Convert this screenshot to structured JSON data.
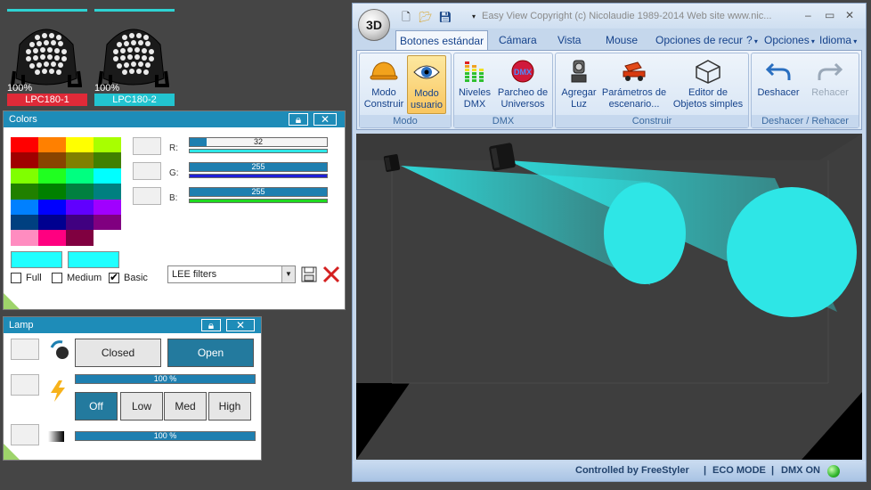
{
  "fixtures": [
    {
      "percent": "100%",
      "name": "LPC180-1",
      "name_color": "#e02a38"
    },
    {
      "percent": "100%",
      "name": "LPC180-2",
      "name_color": "#22c4d0"
    }
  ],
  "colors_panel": {
    "title": "Colors",
    "palette": [
      [
        "#ff0000",
        "#ff8000",
        "#ffff00",
        "#a8ff00"
      ],
      [
        "#a00000",
        "#884400",
        "#808000",
        "#408000"
      ],
      [
        "#80ff00",
        "#20ff20",
        "#00ff80",
        "#00ffff"
      ],
      [
        "#208000",
        "#008000",
        "#008040",
        "#008080"
      ],
      [
        "#0080ff",
        "#0000ff",
        "#6000ff",
        "#a000ff"
      ],
      [
        "#004080",
        "#000090",
        "#400080",
        "#800080"
      ],
      [
        "#ff8cc0",
        "#ff0080",
        "#800040",
        "#ffffff"
      ]
    ],
    "current_color": "#20ffff",
    "previous_color": "#20ffff",
    "r_label": "R:",
    "g_label": "G:",
    "b_label": "B:",
    "r_value": "32",
    "g_value": "255",
    "b_value": "255",
    "r_level": 0.125,
    "g_level": 1.0,
    "b_level": 1.0,
    "full_label": "Full",
    "medium_label": "Medium",
    "basic_label": "Basic",
    "basic_checked": true,
    "filter_selected": "LEE filters"
  },
  "lamp_panel": {
    "title": "Lamp",
    "closed_label": "Closed",
    "open_label": "Open",
    "intensity_value": "100 %",
    "intensity_level": 1.0,
    "strobe_options": [
      "Off",
      "Low",
      "Med",
      "High"
    ],
    "strobe_selected": "Off",
    "dimmer_value": "100 %",
    "dimmer_level": 1.0
  },
  "app": {
    "title": "Easy View   Copyright (c) Nicolaudie 1989-2014    Web site www.nic...",
    "orb_label": "3D",
    "tabs": [
      "Botones estándar",
      "Cámara",
      "Vista",
      "Mouse",
      "Opciones de recur",
      "?",
      "Opciones",
      "Idioma"
    ],
    "active_tab": "Botones estándar",
    "groups": {
      "modo": {
        "name": "Modo",
        "construir": "Modo\nConstruir",
        "usuario": "Modo\nusuario"
      },
      "dmx": {
        "name": "DMX",
        "niveles": "Niveles\nDMX",
        "parcheo": "Parcheo de\nUniversos"
      },
      "construir": {
        "name": "Construir",
        "agregar": "Agregar\nLuz",
        "parametros": "Parámetros de\nescenario...",
        "editor": "Editor de\nObjetos simples"
      },
      "deshacer": {
        "name": "Deshacer / Rehacer",
        "deshacer": "Deshacer",
        "rehacer": "Rehacer"
      }
    },
    "status": {
      "controlled": "Controlled by FreeStyler",
      "eco": "ECO MODE",
      "dmx": "DMX ON",
      "dmx_led_color": "#2fb52b"
    },
    "beam_color": "#2ee6e6"
  }
}
